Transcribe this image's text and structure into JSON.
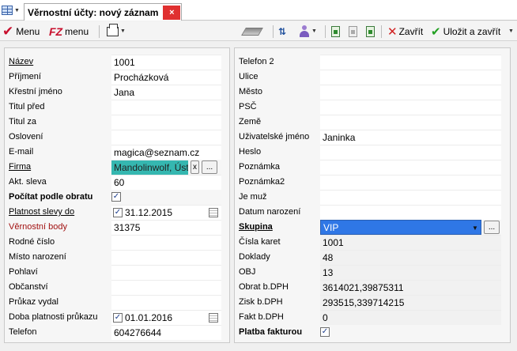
{
  "tab": {
    "title": "Věrnostní účty: nový záznam",
    "close": "×"
  },
  "toolbar": {
    "menu1_label": "Menu",
    "logo_fz": "FZ",
    "menu2_label": "menu",
    "close_label": "Zavřít",
    "save_close_label": "Uložit a zavřít"
  },
  "left_form": [
    {
      "label": "Název",
      "value": "1001",
      "style": "underline"
    },
    {
      "label": "Příjmení",
      "value": "Procházková"
    },
    {
      "label": "Křestní jméno",
      "value": "Jana"
    },
    {
      "label": "Titul před",
      "value": ""
    },
    {
      "label": "Titul za",
      "value": ""
    },
    {
      "label": "Oslovení",
      "value": ""
    },
    {
      "label": "E-mail",
      "value": "magica@seznam.cz"
    },
    {
      "label": "Firma",
      "value": "Mandolinwolf, Ústí n",
      "style": "underline",
      "widget": "lookup"
    },
    {
      "label": "Akt. sleva",
      "value": "60"
    },
    {
      "label": "Počítat podle obratu",
      "value": "",
      "style": "bold",
      "widget": "checkbox",
      "checked": true
    },
    {
      "label": "Platnost slevy do",
      "value": "31.12.2015",
      "style": "underline",
      "widget": "date",
      "checked": true
    },
    {
      "label": "Věrnostní body",
      "value": "31375",
      "style": "red"
    },
    {
      "label": "Rodné číslo",
      "value": ""
    },
    {
      "label": "Místo narození",
      "value": ""
    },
    {
      "label": "Pohlaví",
      "value": ""
    },
    {
      "label": "Občanství",
      "value": ""
    },
    {
      "label": "Průkaz vydal",
      "value": ""
    },
    {
      "label": "Doba platnosti průkazu",
      "value": "01.01.2016",
      "widget": "date",
      "checked": true
    },
    {
      "label": "Telefon",
      "value": "604276644"
    }
  ],
  "right_form": [
    {
      "label": "Telefon 2",
      "value": ""
    },
    {
      "label": "Ulice",
      "value": ""
    },
    {
      "label": "Město",
      "value": ""
    },
    {
      "label": "PSČ",
      "value": ""
    },
    {
      "label": "Země",
      "value": ""
    },
    {
      "label": "Uživatelské jméno",
      "value": "Janinka"
    },
    {
      "label": "Heslo",
      "value": ""
    },
    {
      "label": "Poznámka",
      "value": ""
    },
    {
      "label": "Poznámka2",
      "value": ""
    },
    {
      "label": "Je muž",
      "value": ""
    },
    {
      "label": "Datum narození",
      "value": ""
    },
    {
      "label": "Skupina",
      "value": "VIP",
      "style": "bold-underline",
      "widget": "dropdown"
    },
    {
      "label": "Čísla karet",
      "value": "1001",
      "widget": "readonly"
    },
    {
      "label": "Doklady",
      "value": "48",
      "widget": "readonly"
    },
    {
      "label": "OBJ",
      "value": "13",
      "widget": "readonly"
    },
    {
      "label": "Obrat b.DPH",
      "value": "3614021,39875311",
      "widget": "readonly"
    },
    {
      "label": "Zisk b.DPH",
      "value": "293515,339714215",
      "widget": "readonly"
    },
    {
      "label": "Fakt b.DPH",
      "value": "0",
      "widget": "readonly"
    },
    {
      "label": "Platba fakturou",
      "value": "",
      "style": "bold",
      "widget": "checkbox",
      "checked": true
    }
  ],
  "icons": {
    "lookup_clear": "x",
    "lookup_browse": "...",
    "checkbox_mark": "✓",
    "dropdown_arrow": "▼"
  }
}
